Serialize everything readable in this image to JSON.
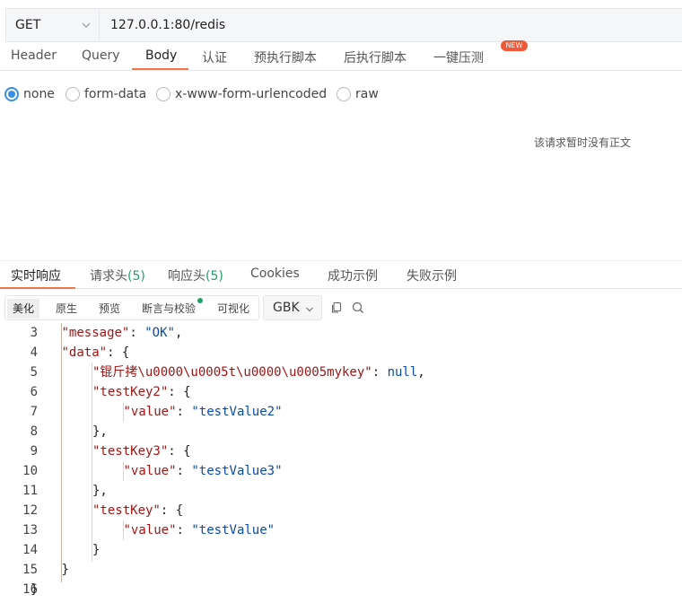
{
  "request": {
    "method": "GET",
    "url": "127.0.0.1:80/redis"
  },
  "request_tabs": [
    {
      "label": "Header"
    },
    {
      "label": "Query"
    },
    {
      "label": "Body"
    },
    {
      "label": "认证"
    },
    {
      "label": "预执行脚本"
    },
    {
      "label": "后执行脚本"
    },
    {
      "label": "一键压测"
    }
  ],
  "new_badge": "NEW",
  "body_types": [
    {
      "label": "none",
      "checked": true
    },
    {
      "label": "form-data",
      "checked": false
    },
    {
      "label": "x-www-form-urlencoded",
      "checked": false
    },
    {
      "label": "raw",
      "checked": false
    }
  ],
  "empty_body_message": "该请求暂时没有正文",
  "response_tabs": [
    {
      "label": "实时响应",
      "count": ""
    },
    {
      "label": "请求头",
      "count": "(5)"
    },
    {
      "label": "响应头",
      "count": "(5)"
    },
    {
      "label": "Cookies",
      "count": ""
    },
    {
      "label": "成功示例",
      "count": ""
    },
    {
      "label": "失败示例",
      "count": ""
    }
  ],
  "view_modes": [
    {
      "label": "美化"
    },
    {
      "label": "原生"
    },
    {
      "label": "预览"
    },
    {
      "label": "断言与校验"
    },
    {
      "label": "可视化"
    }
  ],
  "charset": "GBK",
  "code_lines": [
    {
      "num": "3",
      "indent": 1,
      "parts": [
        {
          "t": "k",
          "v": "\"message\""
        },
        {
          "t": "p",
          "v": ": "
        },
        {
          "t": "s",
          "v": "\"OK\""
        },
        {
          "t": "p",
          "v": ","
        }
      ]
    },
    {
      "num": "4",
      "indent": 1,
      "parts": [
        {
          "t": "k",
          "v": "\"data\""
        },
        {
          "t": "p",
          "v": ": {"
        }
      ]
    },
    {
      "num": "5",
      "indent": 2,
      "parts": [
        {
          "t": "k",
          "v": "\"锟斤拷\\u0000\\u0005t\\u0000\\u0005mykey\""
        },
        {
          "t": "p",
          "v": ": "
        },
        {
          "t": "n",
          "v": "null"
        },
        {
          "t": "p",
          "v": ","
        }
      ]
    },
    {
      "num": "6",
      "indent": 2,
      "parts": [
        {
          "t": "k",
          "v": "\"testKey2\""
        },
        {
          "t": "p",
          "v": ": {"
        }
      ]
    },
    {
      "num": "7",
      "indent": 3,
      "parts": [
        {
          "t": "k",
          "v": "\"value\""
        },
        {
          "t": "p",
          "v": ": "
        },
        {
          "t": "s",
          "v": "\"testValue2\""
        }
      ]
    },
    {
      "num": "8",
      "indent": 2,
      "parts": [
        {
          "t": "p",
          "v": "},"
        }
      ]
    },
    {
      "num": "9",
      "indent": 2,
      "parts": [
        {
          "t": "k",
          "v": "\"testKey3\""
        },
        {
          "t": "p",
          "v": ": {"
        }
      ]
    },
    {
      "num": "10",
      "indent": 3,
      "parts": [
        {
          "t": "k",
          "v": "\"value\""
        },
        {
          "t": "p",
          "v": ": "
        },
        {
          "t": "s",
          "v": "\"testValue3\""
        }
      ]
    },
    {
      "num": "11",
      "indent": 2,
      "parts": [
        {
          "t": "p",
          "v": "},"
        }
      ]
    },
    {
      "num": "12",
      "indent": 2,
      "parts": [
        {
          "t": "k",
          "v": "\"testKey\""
        },
        {
          "t": "p",
          "v": ": {"
        }
      ]
    },
    {
      "num": "13",
      "indent": 3,
      "parts": [
        {
          "t": "k",
          "v": "\"value\""
        },
        {
          "t": "p",
          "v": ": "
        },
        {
          "t": "s",
          "v": "\"testValue\""
        }
      ]
    },
    {
      "num": "14",
      "indent": 2,
      "parts": [
        {
          "t": "p",
          "v": "}"
        }
      ]
    },
    {
      "num": "15",
      "indent": 1,
      "parts": [
        {
          "t": "p",
          "v": "}"
        }
      ]
    },
    {
      "num": "16",
      "indent": 0,
      "parts": [
        {
          "t": "p",
          "v": "}"
        }
      ]
    }
  ],
  "colors": {
    "accent": "#f2744a",
    "radio_checked": "#3a8ee6",
    "count_green": "#21a366",
    "json_key": "#a31515",
    "json_value": "#0b4aa8",
    "new_badge": "#f0593a"
  },
  "icons": [
    "chevron-down-icon",
    "copy-icon",
    "search-icon"
  ]
}
